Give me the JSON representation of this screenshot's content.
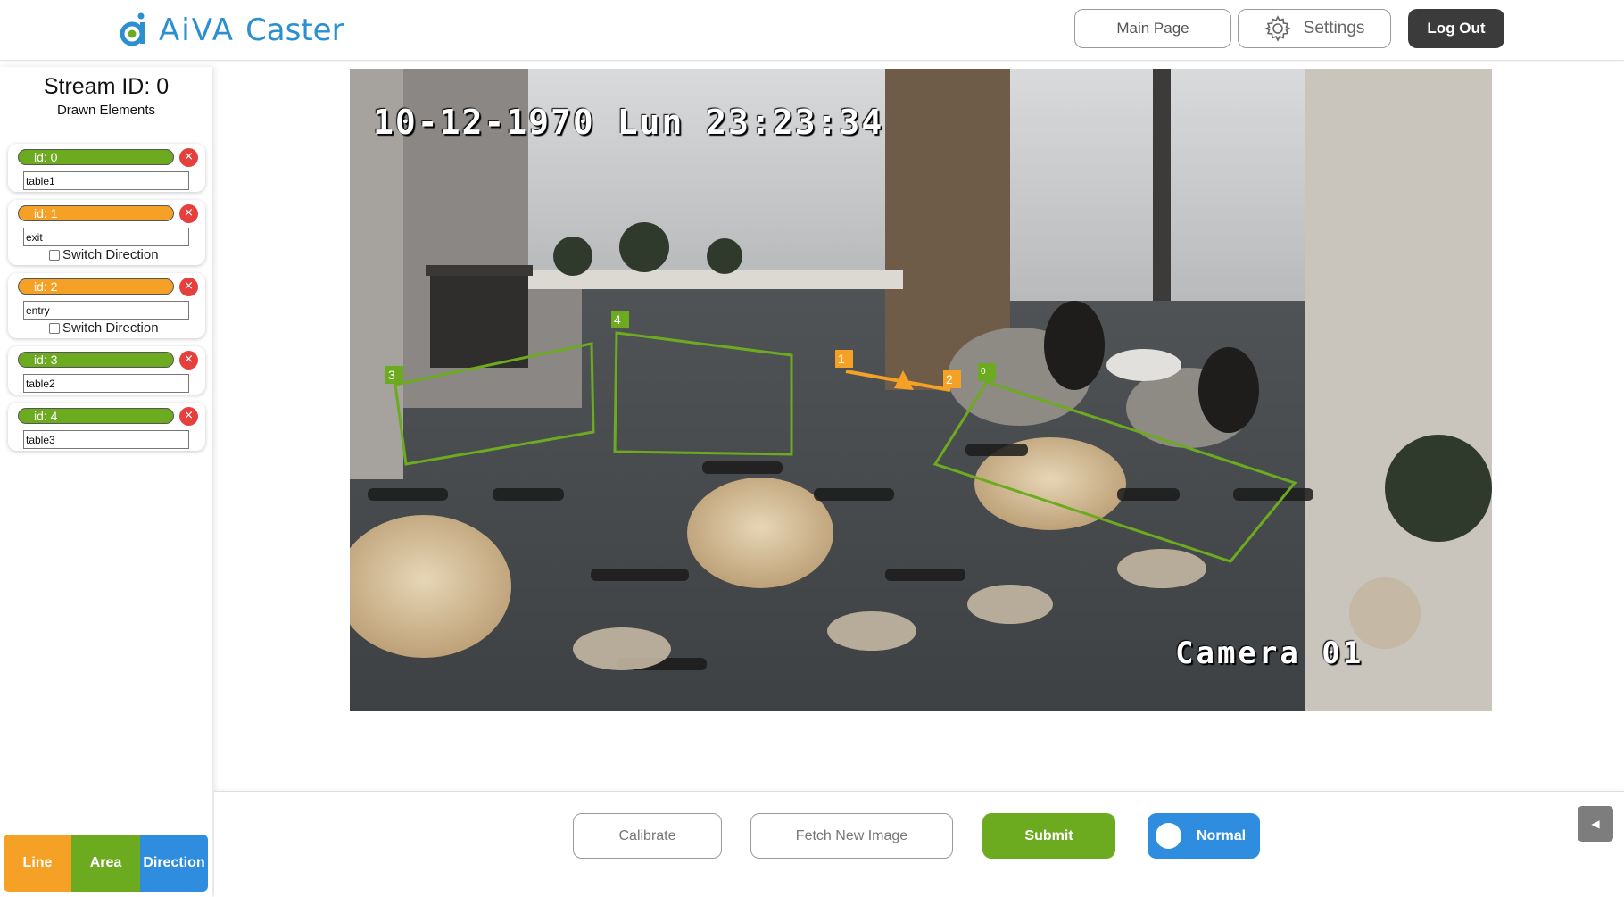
{
  "header": {
    "logo_aiva": "AiVA",
    "logo_caster": "Caster",
    "main_page_label": "Main Page",
    "settings_label": "Settings",
    "logout_label": "Log Out"
  },
  "sidebar": {
    "stream_title": "Stream ID: 0",
    "drawn_elements_title": "Drawn Elements",
    "elements": [
      {
        "id_label": "id: 0",
        "name": "table1",
        "type": "area",
        "has_switch": false
      },
      {
        "id_label": "id: 1",
        "name": "exit",
        "type": "line",
        "has_switch": true,
        "switch_label": "Switch Direction",
        "switch_checked": false
      },
      {
        "id_label": "id: 2",
        "name": "entry",
        "type": "line",
        "has_switch": true,
        "switch_label": "Switch Direction",
        "switch_checked": false
      },
      {
        "id_label": "id: 3",
        "name": "table2",
        "type": "area",
        "has_switch": false
      },
      {
        "id_label": "id: 4",
        "name": "table3",
        "type": "area",
        "has_switch": false
      }
    ],
    "delete_symbol": "×",
    "mode_buttons": {
      "line": "Line",
      "area": "Area",
      "direction": "Direction"
    }
  },
  "camera": {
    "timestamp": "10-12-1970 Lun 23:23:34",
    "camera_label": "Camera 01",
    "tags": {
      "t0": "0",
      "t1": "1",
      "t2": "2",
      "t3": "3",
      "t4": "4"
    }
  },
  "bottom": {
    "calibrate_label": "Calibrate",
    "fetch_label": "Fetch New Image",
    "submit_label": "Submit",
    "normal_label": "Normal"
  },
  "colors": {
    "area": "#6cab20",
    "line": "#f5a126",
    "direction": "#2f8de0",
    "delete": "#e6403d",
    "brand": "#2b8fd0"
  },
  "icons": [
    "logo-icon",
    "gear-icon",
    "close-icon",
    "caret-left-icon"
  ]
}
